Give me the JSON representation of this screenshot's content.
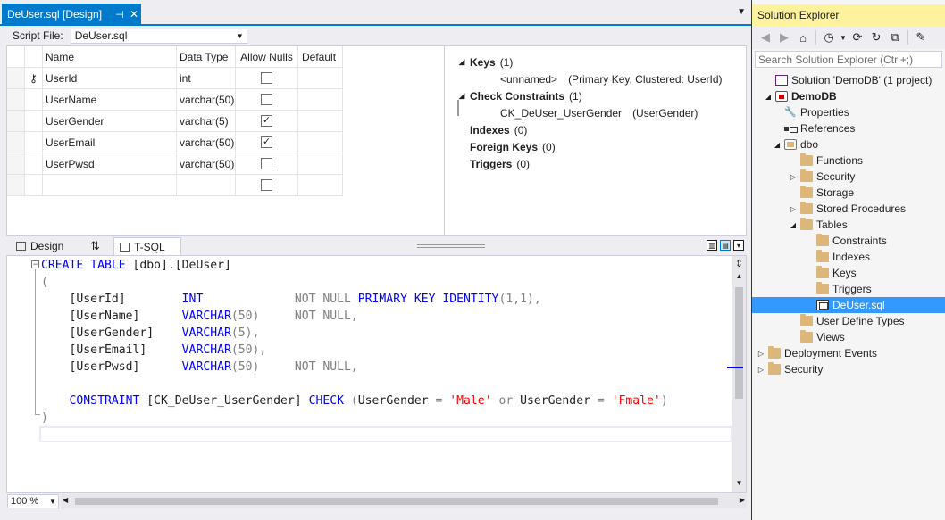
{
  "document": {
    "tab_title": "DeUser.sql [Design]",
    "pin_glyph": "⊣",
    "close_glyph": "✕",
    "dropdown_glyph": "▼"
  },
  "script_file": {
    "label": "Script File:",
    "value": "DeUser.sql"
  },
  "grid": {
    "headers": {
      "name": "Name",
      "type": "Data Type",
      "nulls": "Allow Nulls",
      "default": "Default"
    },
    "rows": [
      {
        "name": "UserId",
        "type": "int",
        "allow_nulls": false,
        "key": true
      },
      {
        "name": "UserName",
        "type": "varchar(50)",
        "allow_nulls": false,
        "key": false
      },
      {
        "name": "UserGender",
        "type": "varchar(5)",
        "allow_nulls": true,
        "key": false
      },
      {
        "name": "UserEmail",
        "type": "varchar(50)",
        "allow_nulls": true,
        "key": false
      },
      {
        "name": "UserPwsd",
        "type": "varchar(50)",
        "allow_nulls": false,
        "key": false
      },
      {
        "name": "",
        "type": "",
        "allow_nulls": false,
        "key": false
      }
    ]
  },
  "properties": {
    "keys": {
      "label": "Keys",
      "count": "(1)"
    },
    "key_item": {
      "name": "<unnamed>",
      "detail": "(Primary Key, Clustered: UserId)"
    },
    "check": {
      "label": "Check Constraints",
      "count": "(1)"
    },
    "check_item": {
      "name": "CK_DeUser_UserGender",
      "detail": "(UserGender)"
    },
    "indexes": {
      "label": "Indexes",
      "count": "(0)"
    },
    "foreign": {
      "label": "Foreign Keys",
      "count": "(0)"
    },
    "triggers": {
      "label": "Triggers",
      "count": "(0)"
    }
  },
  "pane_tabs": {
    "design": "Design",
    "swap": "⇅",
    "tsql": "T-SQL"
  },
  "code": {
    "l1_kw": "CREATE TABLE",
    "l1_rest": " [dbo].[DeUser]",
    "open_paren": "(",
    "c1_name": "    [UserId]        ",
    "c1_type": "INT",
    "c1_pad": "             ",
    "c1_notnull": "NOT NULL",
    "c1_pk": " PRIMARY KEY IDENTITY",
    "c1_args": "(1,1),",
    "c2_name": "    [UserName]      ",
    "c2_type": "VARCHAR",
    "c2_args": "(50)",
    "c2_pad": "     ",
    "c2_notnull": "NOT NULL,",
    "c3_name": "    [UserGender]    ",
    "c3_type": "VARCHAR",
    "c3_args": "(5),",
    "c4_name": "    [UserEmail]     ",
    "c4_type": "VARCHAR",
    "c4_args": "(50),",
    "c5_name": "    [UserPwsd]      ",
    "c5_type": "VARCHAR",
    "c5_args": "(50)",
    "c5_pad": "     ",
    "c5_notnull": "NOT NULL,",
    "con_kw": "    CONSTRAINT",
    "con_name": " [CK_DeUser_UserGender] ",
    "con_check": "CHECK",
    "con_open": " (",
    "con_col1": "UserGender ",
    "con_eq1": "=",
    "con_val1": " 'Male'",
    "con_or": " or ",
    "con_col2": "UserGender ",
    "con_eq2": "=",
    "con_val2": " 'Fmale'",
    "con_close": ")",
    "close_paren": ")"
  },
  "status": {
    "zoom": "100 %"
  },
  "solution_explorer": {
    "title": "Solution Explorer",
    "search_placeholder": "Search Solution Explorer (Ctrl+;)",
    "nodes": [
      {
        "label": "Solution 'DemoDB' (1 project)"
      },
      {
        "label": "DemoDB"
      },
      {
        "label": "Properties"
      },
      {
        "label": "References"
      },
      {
        "label": "dbo"
      },
      {
        "label": "Functions"
      },
      {
        "label": "Security"
      },
      {
        "label": "Storage"
      },
      {
        "label": "Stored Procedures"
      },
      {
        "label": "Tables"
      },
      {
        "label": "Constraints"
      },
      {
        "label": "Indexes"
      },
      {
        "label": "Keys"
      },
      {
        "label": "Triggers"
      },
      {
        "label": "DeUser.sql"
      },
      {
        "label": "User Define Types"
      },
      {
        "label": "Views"
      },
      {
        "label": "Deployment Events"
      },
      {
        "label": "Security"
      }
    ]
  },
  "colors": {
    "accent": "#007acc",
    "selection": "#3399ff",
    "title_highlight": "#fff29d",
    "keyword": "#0000ff",
    "string": "#ff0000",
    "operator": "#808080"
  }
}
